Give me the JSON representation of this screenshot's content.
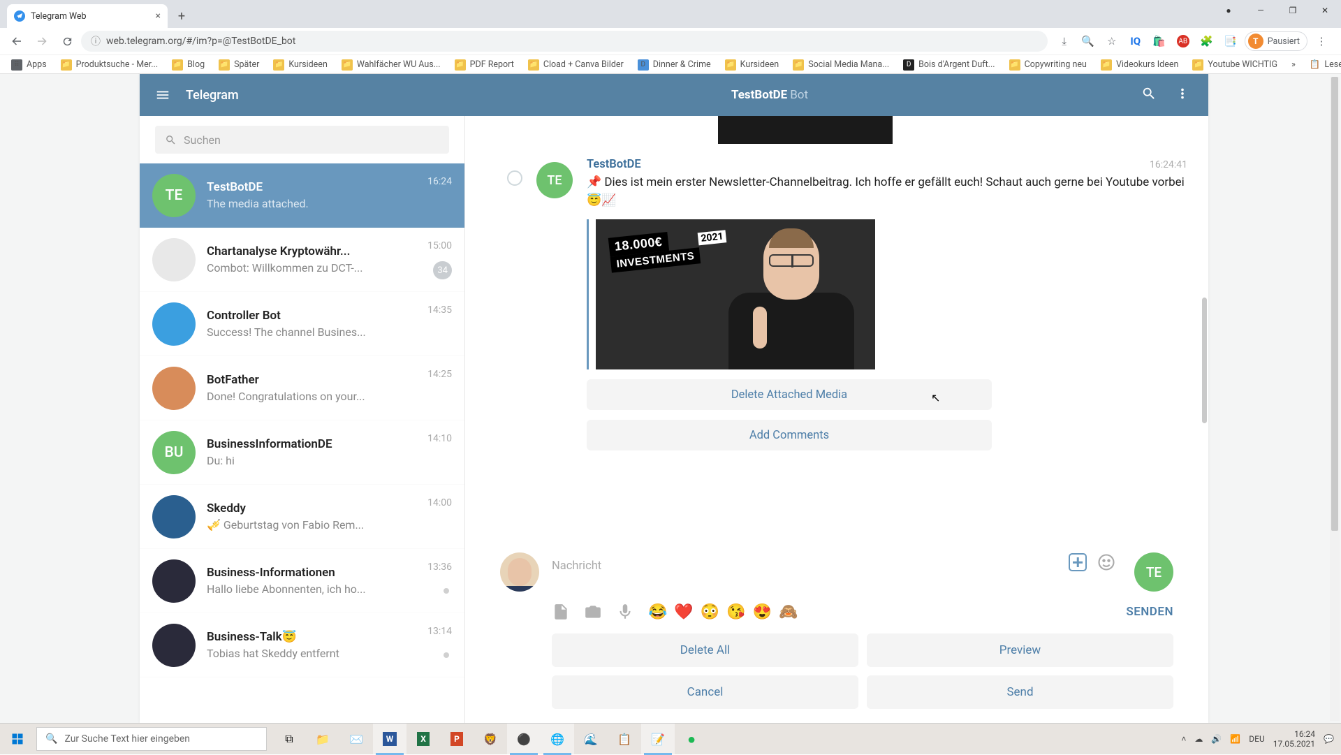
{
  "browser": {
    "tab_title": "Telegram Web",
    "url": "web.telegram.org/#/im?p=@TestBotDE_bot",
    "profile_label": "Pausiert",
    "profile_initial": "T",
    "bookmarks": [
      "Apps",
      "Produktsuche - Mer...",
      "Blog",
      "Später",
      "Kursideen",
      "Wahlfächer WU Aus...",
      "PDF Report",
      "Cload + Canva Bilder",
      "Dinner & Crime",
      "Kursideen",
      "Social Media Mana...",
      "Bois d'Argent Duft...",
      "Copywriting neu",
      "Videokurs Ideen",
      "Youtube WICHTIG"
    ],
    "bookmark_right": "Leseliste"
  },
  "telegram": {
    "app_title": "Telegram",
    "chat_header_name": "TestBotDE",
    "chat_header_badge": "Bot",
    "search_placeholder": "Suchen"
  },
  "chats": [
    {
      "name": "TestBotDE",
      "preview": "The media attached.",
      "time": "16:24",
      "avatar": "TE",
      "color": "#6ec26e",
      "active": true
    },
    {
      "name": "Chartanalyse Kryptowähr...",
      "preview": "Combot: Willkommen zu DCT-...",
      "time": "15:00",
      "avatar": "",
      "color": "#e8e8e8",
      "unread": "34"
    },
    {
      "name": "Controller Bot",
      "preview": "Success! The channel Busines...",
      "time": "14:35",
      "avatar": "",
      "color": "#3b9fe0"
    },
    {
      "name": "BotFather",
      "preview": "Done! Congratulations on your...",
      "time": "14:25",
      "avatar": "",
      "color": "#d88c5a"
    },
    {
      "name": "BusinessInformationDE",
      "preview": "Du: hi",
      "time": "14:10",
      "avatar": "BU",
      "color": "#6ec26e"
    },
    {
      "name": "Skeddy",
      "preview": "🎺 Geburtstag von Fabio Rem...",
      "time": "14:00",
      "avatar": "",
      "color": "#2a5f8f"
    },
    {
      "name": "Business-Informationen",
      "preview": "Hallo liebe Abonnenten, ich ho...",
      "time": "13:36",
      "avatar": "",
      "color": "#2a2a3a",
      "dot": true
    },
    {
      "name": "Business-Talk😇",
      "preview": "Tobias hat Skeddy entfernt",
      "time": "13:14",
      "avatar": "",
      "color": "#2a2a3a",
      "dot": true
    }
  ],
  "message": {
    "sender": "TestBotDE",
    "time": "16:24:41",
    "avatar": "TE",
    "text": "📌 Dies ist mein erster Newsletter-Channelbeitrag. Ich hoffe er gefällt euch! Schaut auch gerne bei Youtube vorbei 😇📈",
    "thumb_main": "18.000€",
    "thumb_sub": "INVESTMENTS",
    "thumb_year": "2021",
    "btn_delete_media": "Delete Attached Media",
    "btn_add_comments": "Add Comments"
  },
  "compose": {
    "placeholder": "Nachricht",
    "send_label": "SENDEN",
    "send_avatar": "TE",
    "emojis": [
      "😂",
      "❤️",
      "😳",
      "😘",
      "😍",
      "🙈"
    ],
    "buttons": {
      "delete_all": "Delete All",
      "preview": "Preview",
      "cancel": "Cancel",
      "send": "Send"
    }
  },
  "taskbar": {
    "search_placeholder": "Zur Suche Text hier eingeben",
    "lang": "DEU",
    "time": "16:24",
    "date": "17.05.2021"
  }
}
